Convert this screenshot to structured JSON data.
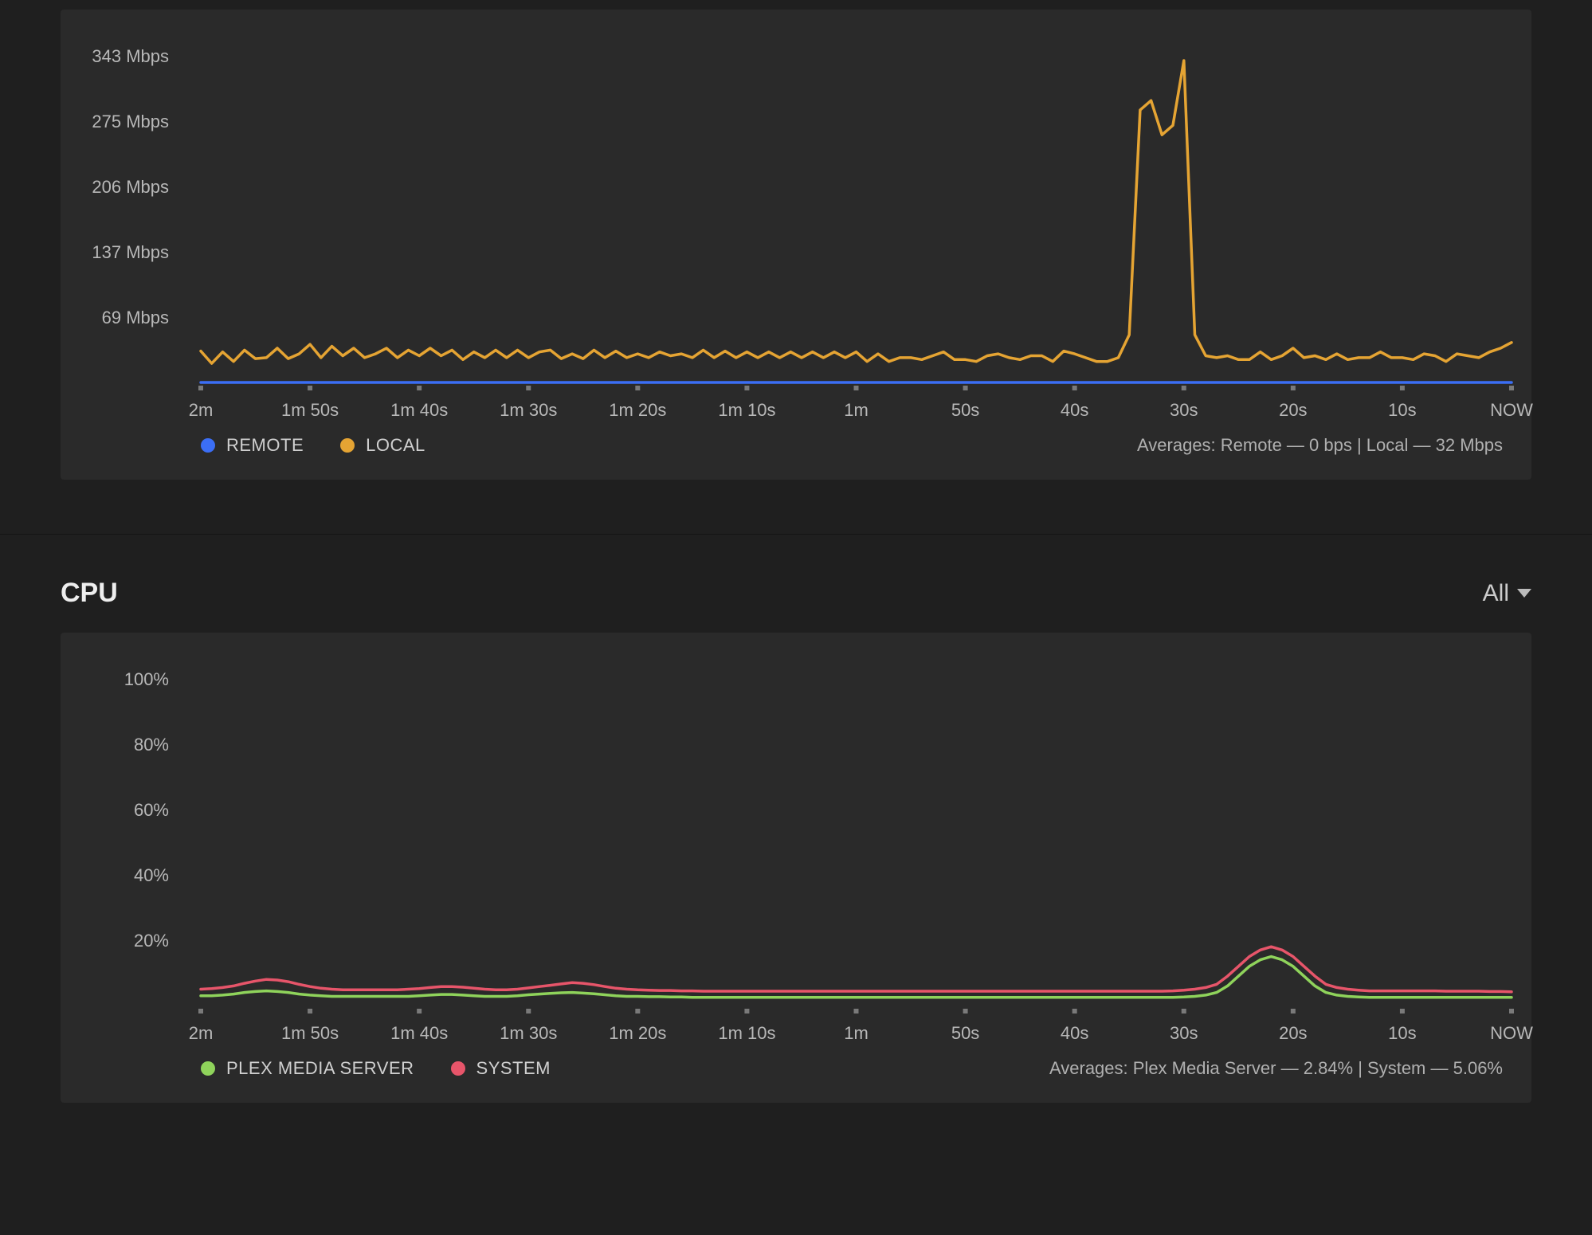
{
  "bandwidth": {
    "legend": {
      "remote": "REMOTE",
      "local": "LOCAL"
    },
    "averages_label": "Averages: Remote  —  0 bps  |  Local  —  32 Mbps",
    "colors": {
      "remote": "#3b6ef5",
      "local": "#e5a433"
    }
  },
  "cpu": {
    "title": "CPU",
    "filter_label": "All",
    "legend": {
      "pms": "PLEX MEDIA SERVER",
      "system": "SYSTEM"
    },
    "averages_label": "Averages: Plex Media Server  —  2.84%  |  System  —  5.06%",
    "colors": {
      "pms": "#8fd35b",
      "system": "#e7556a"
    }
  },
  "chart_data": [
    {
      "id": "bandwidth",
      "type": "line",
      "title": "",
      "xlabel": "",
      "ylabel": "",
      "x_categories": [
        "2m",
        "1m 50s",
        "1m 40s",
        "1m 30s",
        "1m 20s",
        "1m 10s",
        "1m",
        "50s",
        "40s",
        "30s",
        "20s",
        "10s",
        "NOW"
      ],
      "y_ticks": [
        "69 Mbps",
        "137 Mbps",
        "206 Mbps",
        "275 Mbps",
        "343 Mbps"
      ],
      "ylim": [
        0,
        343
      ],
      "series": [
        {
          "name": "REMOTE",
          "color": "#3b6ef5",
          "values": [
            0,
            0,
            0,
            0,
            0,
            0,
            0,
            0,
            0,
            0,
            0,
            0,
            0,
            0,
            0,
            0,
            0,
            0,
            0,
            0,
            0,
            0,
            0,
            0,
            0,
            0,
            0,
            0,
            0,
            0,
            0,
            0,
            0,
            0,
            0,
            0,
            0,
            0,
            0,
            0,
            0,
            0,
            0,
            0,
            0,
            0,
            0,
            0,
            0,
            0,
            0,
            0,
            0,
            0,
            0,
            0,
            0,
            0,
            0,
            0,
            0,
            0,
            0,
            0,
            0,
            0,
            0,
            0,
            0,
            0,
            0,
            0,
            0,
            0,
            0,
            0,
            0,
            0,
            0,
            0,
            0,
            0,
            0,
            0,
            0,
            0,
            0,
            0,
            0,
            0,
            0,
            0,
            0,
            0,
            0,
            0,
            0,
            0,
            0,
            0,
            0,
            0,
            0,
            0,
            0,
            0,
            0,
            0,
            0,
            0,
            0,
            0,
            0,
            0,
            0,
            0,
            0,
            0,
            0,
            0,
            0
          ]
        },
        {
          "name": "LOCAL",
          "color": "#e5a433",
          "values": [
            33,
            20,
            32,
            22,
            34,
            25,
            26,
            36,
            25,
            30,
            40,
            26,
            38,
            28,
            36,
            26,
            30,
            36,
            26,
            34,
            28,
            36,
            28,
            34,
            24,
            32,
            26,
            34,
            26,
            34,
            26,
            32,
            34,
            25,
            30,
            25,
            34,
            26,
            33,
            26,
            30,
            26,
            32,
            28,
            30,
            26,
            34,
            26,
            33,
            26,
            32,
            26,
            32,
            26,
            32,
            26,
            32,
            26,
            32,
            26,
            32,
            22,
            30,
            22,
            26,
            26,
            24,
            28,
            32,
            24,
            24,
            22,
            28,
            30,
            26,
            24,
            28,
            28,
            22,
            33,
            30,
            26,
            22,
            22,
            26,
            50,
            286,
            296,
            260,
            270,
            338,
            50,
            28,
            26,
            28,
            24,
            24,
            32,
            24,
            28,
            36,
            26,
            28,
            24,
            30,
            24,
            26,
            26,
            32,
            26,
            26,
            24,
            30,
            28,
            22,
            30,
            28,
            26,
            32,
            36,
            42
          ]
        }
      ]
    },
    {
      "id": "cpu",
      "type": "line",
      "title": "CPU",
      "xlabel": "",
      "ylabel": "",
      "x_categories": [
        "2m",
        "1m 50s",
        "1m 40s",
        "1m 30s",
        "1m 20s",
        "1m 10s",
        "1m",
        "50s",
        "40s",
        "30s",
        "20s",
        "10s",
        "NOW"
      ],
      "y_ticks": [
        "20%",
        "40%",
        "60%",
        "80%",
        "100%"
      ],
      "ylim": [
        0,
        100
      ],
      "series": [
        {
          "name": "PLEX MEDIA SERVER",
          "color": "#8fd35b",
          "values": [
            3.0,
            3.0,
            3.2,
            3.5,
            4.0,
            4.3,
            4.5,
            4.3,
            4.0,
            3.5,
            3.2,
            3.0,
            2.8,
            2.8,
            2.8,
            2.8,
            2.8,
            2.8,
            2.8,
            2.8,
            3.0,
            3.2,
            3.4,
            3.4,
            3.2,
            3.0,
            2.8,
            2.8,
            2.8,
            3.0,
            3.3,
            3.5,
            3.7,
            3.9,
            4.0,
            3.8,
            3.6,
            3.3,
            3.0,
            2.8,
            2.8,
            2.7,
            2.7,
            2.6,
            2.6,
            2.5,
            2.5,
            2.5,
            2.5,
            2.5,
            2.5,
            2.5,
            2.5,
            2.5,
            2.5,
            2.5,
            2.5,
            2.5,
            2.5,
            2.5,
            2.5,
            2.5,
            2.5,
            2.5,
            2.5,
            2.5,
            2.5,
            2.5,
            2.5,
            2.5,
            2.5,
            2.5,
            2.5,
            2.5,
            2.5,
            2.5,
            2.5,
            2.5,
            2.5,
            2.5,
            2.5,
            2.5,
            2.5,
            2.5,
            2.5,
            2.5,
            2.5,
            2.5,
            2.5,
            2.5,
            2.6,
            2.8,
            3.2,
            4.0,
            6.0,
            9.0,
            12.0,
            14.0,
            15.0,
            14.0,
            12.0,
            9.0,
            6.0,
            4.0,
            3.2,
            2.8,
            2.6,
            2.5,
            2.5,
            2.5,
            2.5,
            2.5,
            2.5,
            2.5,
            2.5,
            2.5,
            2.5,
            2.5,
            2.5,
            2.5,
            2.5
          ]
        },
        {
          "name": "SYSTEM",
          "color": "#e7556a",
          "values": [
            5.0,
            5.2,
            5.5,
            6.0,
            6.8,
            7.5,
            8.0,
            7.8,
            7.3,
            6.5,
            5.8,
            5.3,
            5.0,
            4.8,
            4.8,
            4.8,
            4.8,
            4.8,
            4.8,
            5.0,
            5.2,
            5.5,
            5.8,
            5.8,
            5.6,
            5.3,
            5.0,
            4.8,
            4.8,
            5.0,
            5.4,
            5.8,
            6.2,
            6.6,
            7.0,
            6.8,
            6.4,
            5.8,
            5.3,
            5.0,
            4.8,
            4.7,
            4.6,
            4.6,
            4.5,
            4.5,
            4.4,
            4.4,
            4.4,
            4.4,
            4.4,
            4.4,
            4.4,
            4.4,
            4.4,
            4.4,
            4.4,
            4.4,
            4.4,
            4.4,
            4.4,
            4.4,
            4.4,
            4.4,
            4.4,
            4.4,
            4.4,
            4.4,
            4.4,
            4.4,
            4.4,
            4.4,
            4.4,
            4.4,
            4.4,
            4.4,
            4.4,
            4.4,
            4.4,
            4.4,
            4.4,
            4.4,
            4.4,
            4.4,
            4.4,
            4.4,
            4.4,
            4.4,
            4.4,
            4.5,
            4.7,
            5.0,
            5.5,
            6.5,
            9.0,
            12.0,
            15.0,
            17.0,
            18.0,
            17.0,
            15.0,
            12.0,
            9.0,
            6.5,
            5.5,
            5.0,
            4.7,
            4.5,
            4.5,
            4.5,
            4.5,
            4.5,
            4.5,
            4.5,
            4.4,
            4.4,
            4.4,
            4.4,
            4.3,
            4.3,
            4.2
          ]
        }
      ]
    }
  ]
}
